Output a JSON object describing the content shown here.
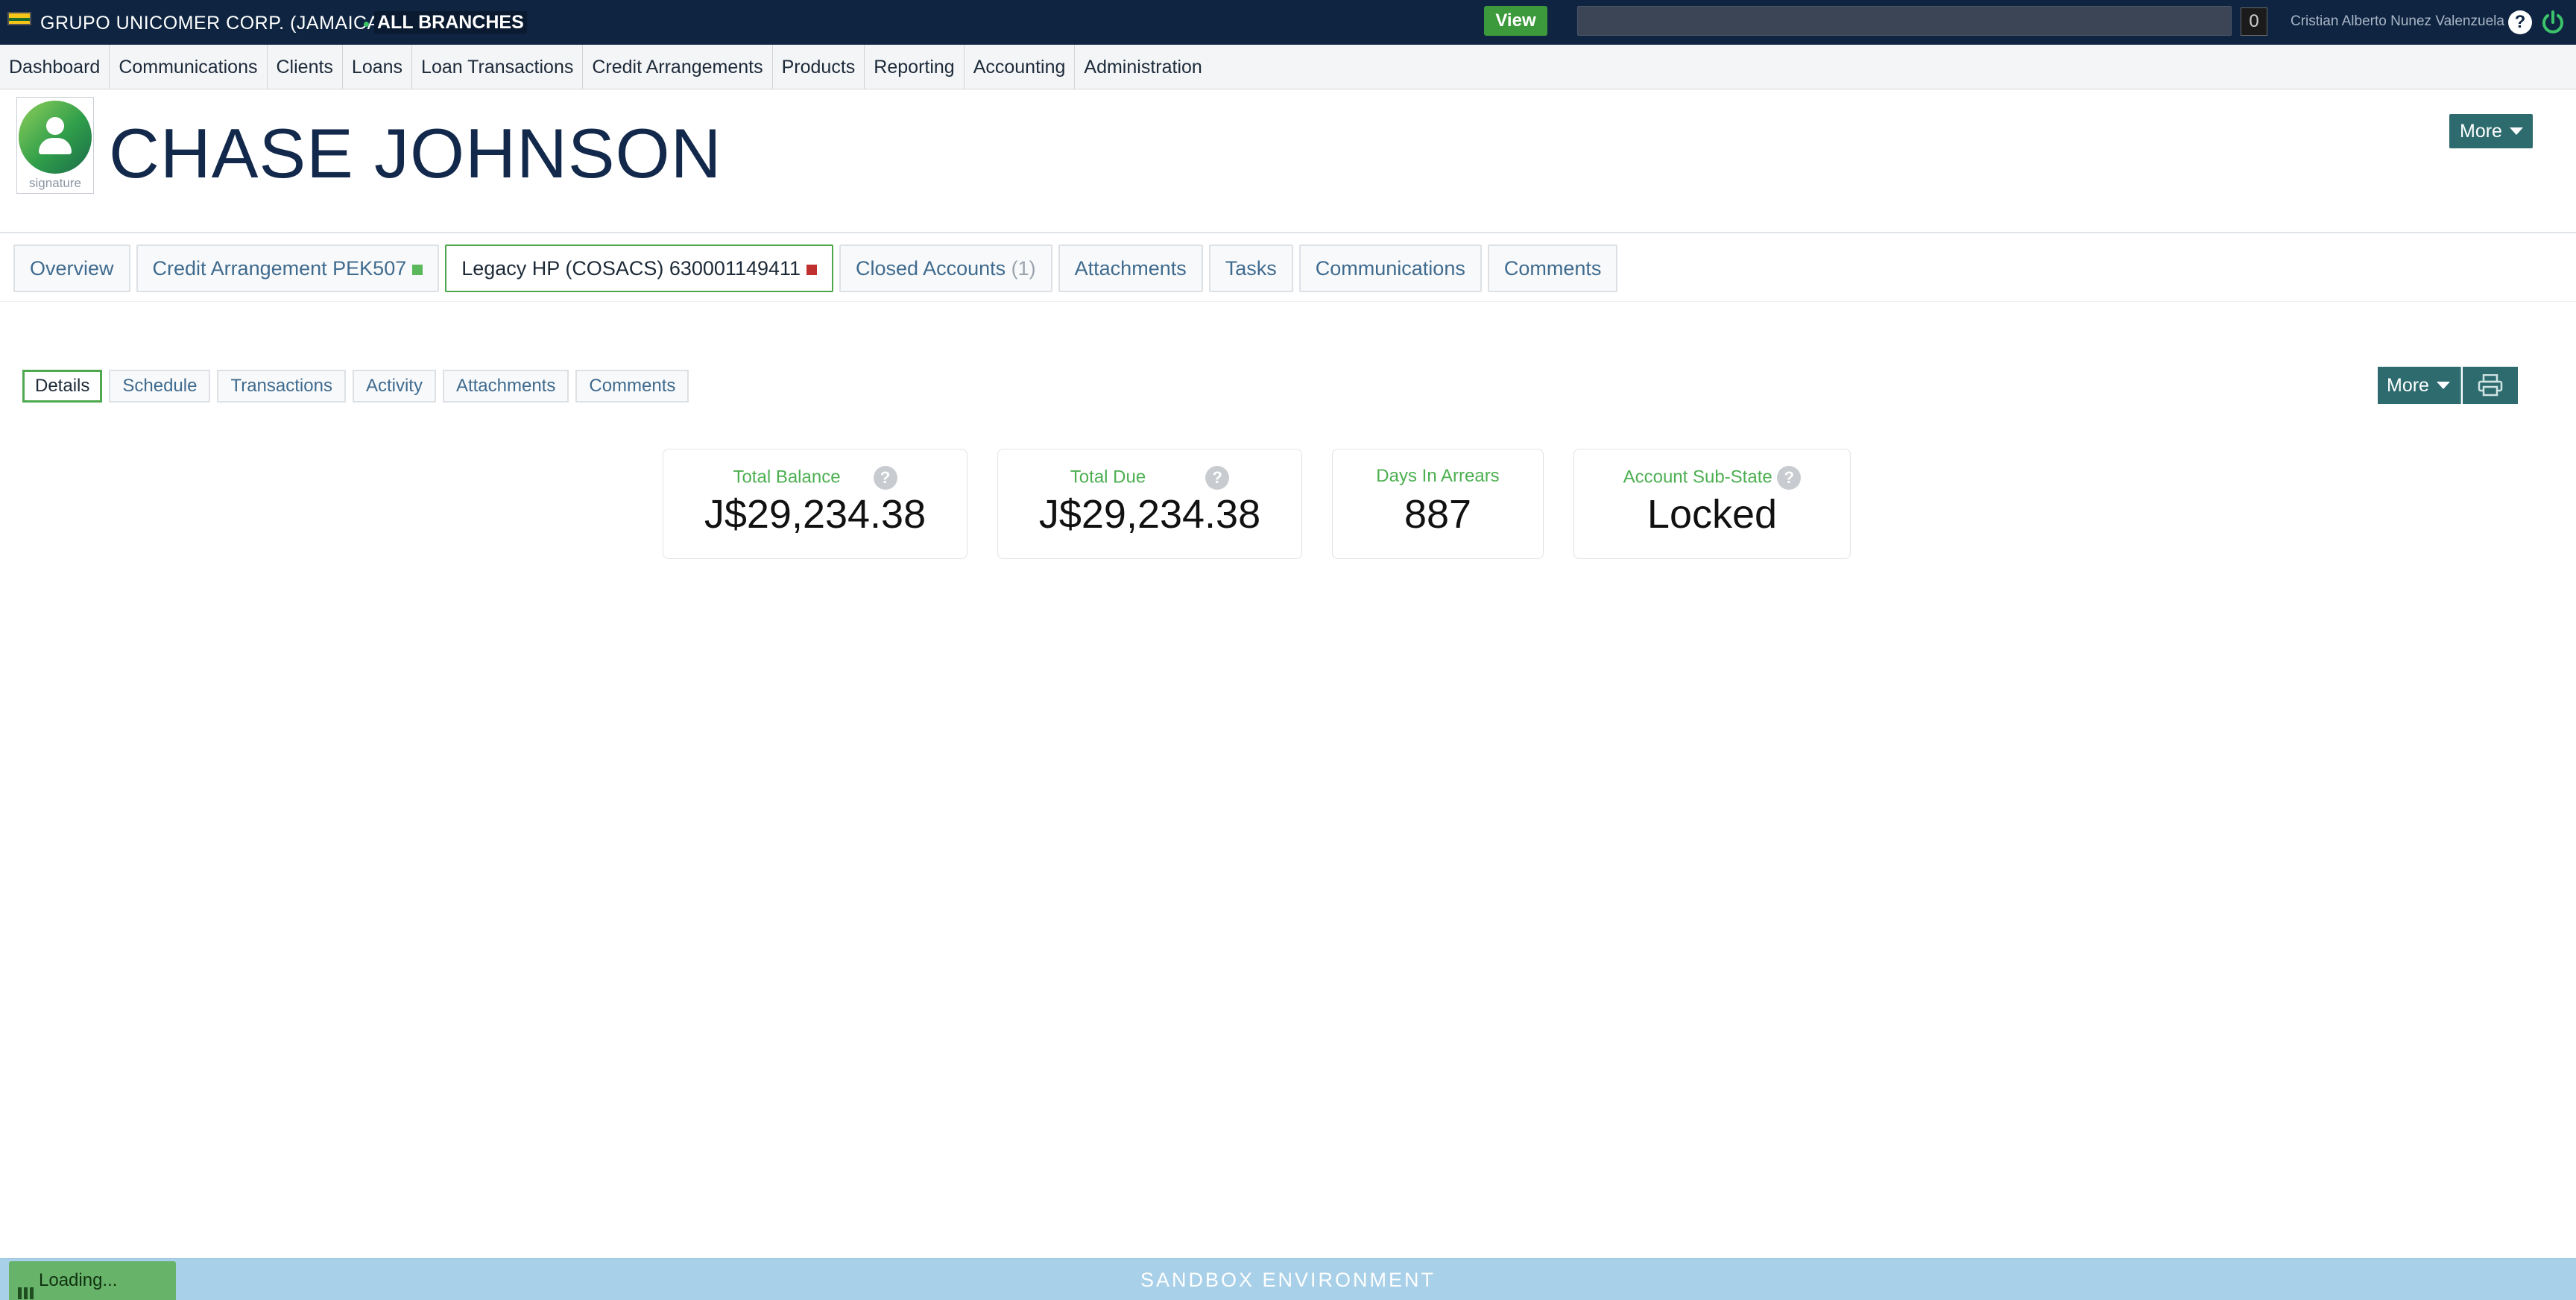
{
  "topbar": {
    "org": "GRUPO UNICOMER CORP. (JAMAICA)",
    "branch": "ALL BRANCHES",
    "view_label": "View",
    "search_value": "",
    "count": "0",
    "user": "Cristian Alberto Nunez Valenzuela",
    "help": "?"
  },
  "nav": [
    "Dashboard",
    "Communications",
    "Clients",
    "Loans",
    "Loan Transactions",
    "Credit Arrangements",
    "Products",
    "Reporting",
    "Accounting",
    "Administration"
  ],
  "header": {
    "client_name": "CHASE JOHNSON",
    "signature_label": "signature",
    "more_label": "More"
  },
  "tabs": {
    "overview": "Overview",
    "credit_arrangement": "Credit Arrangement PEK507",
    "legacy": "Legacy HP (COSACS) 630001149411",
    "closed": "Closed Accounts",
    "closed_count": "(1)",
    "attachments": "Attachments",
    "tasks": "Tasks",
    "communications": "Communications",
    "comments": "Comments"
  },
  "subtabs": [
    "Details",
    "Schedule",
    "Transactions",
    "Activity",
    "Attachments",
    "Comments"
  ],
  "actions": {
    "more_label": "More"
  },
  "stats": {
    "total_balance_label": "Total Balance",
    "total_balance": "J$29,234.38",
    "total_due_label": "Total Due",
    "total_due": "J$29,234.38",
    "days_label": "Days In Arrears",
    "days": "887",
    "substate_label": "Account Sub-State",
    "substate": "Locked",
    "help": "?"
  },
  "footer": {
    "env": "SANDBOX ENVIRONMENT",
    "loading": "Loading..."
  },
  "colors": {
    "topbar": "#0e2440",
    "accent_green": "#4caf50",
    "action_teal": "#2e6b6e",
    "footer": "#a8d0e8"
  }
}
